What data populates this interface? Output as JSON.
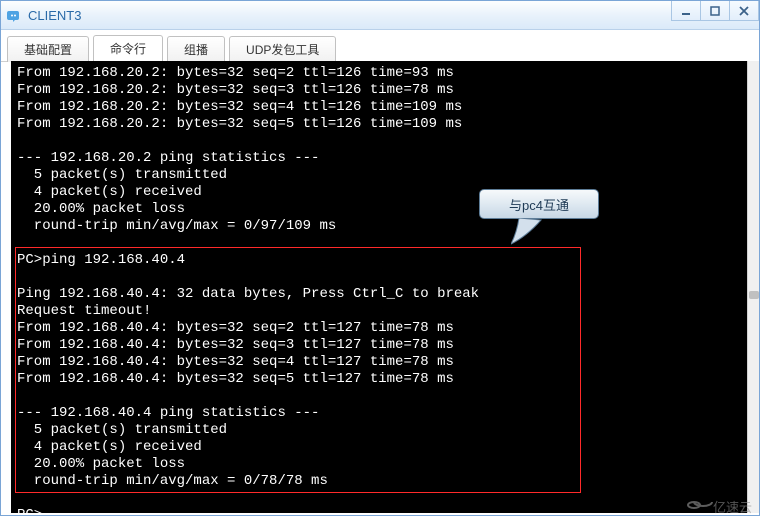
{
  "window": {
    "title": "CLIENT3"
  },
  "tabs": {
    "t0": "基础配置",
    "t1": "命令行",
    "t2": "组播",
    "t3": "UDP发包工具"
  },
  "callout": {
    "text": "与pc4互通"
  },
  "terminal": {
    "lines": [
      "From 192.168.20.2: bytes=32 seq=2 ttl=126 time=93 ms",
      "From 192.168.20.2: bytes=32 seq=3 ttl=126 time=78 ms",
      "From 192.168.20.2: bytes=32 seq=4 ttl=126 time=109 ms",
      "From 192.168.20.2: bytes=32 seq=5 ttl=126 time=109 ms",
      "",
      "--- 192.168.20.2 ping statistics ---",
      "  5 packet(s) transmitted",
      "  4 packet(s) received",
      "  20.00% packet loss",
      "  round-trip min/avg/max = 0/97/109 ms",
      "",
      "PC>ping 192.168.40.4",
      "",
      "Ping 192.168.40.4: 32 data bytes, Press Ctrl_C to break",
      "Request timeout!",
      "From 192.168.40.4: bytes=32 seq=2 ttl=127 time=78 ms",
      "From 192.168.40.4: bytes=32 seq=3 ttl=127 time=78 ms",
      "From 192.168.40.4: bytes=32 seq=4 ttl=127 time=78 ms",
      "From 192.168.40.4: bytes=32 seq=5 ttl=127 time=78 ms",
      "",
      "--- 192.168.40.4 ping statistics ---",
      "  5 packet(s) transmitted",
      "  4 packet(s) received",
      "  20.00% packet loss",
      "  round-trip min/avg/max = 0/78/78 ms",
      "",
      "PC>"
    ]
  },
  "watermark": {
    "text": "亿速云"
  }
}
